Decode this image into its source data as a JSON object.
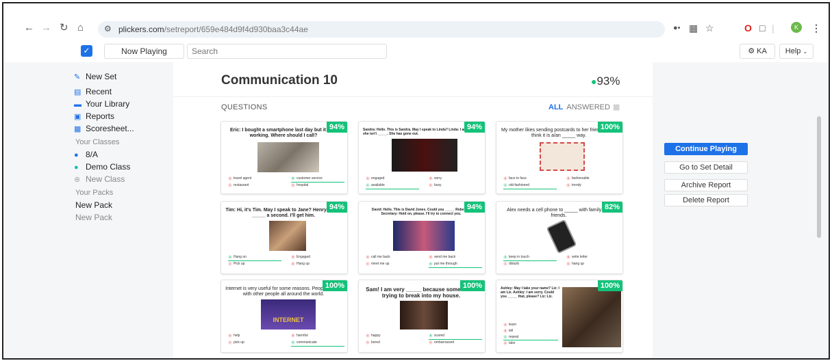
{
  "browser": {
    "url_host": "plickers.com",
    "url_path": "/setreport/659e484d9f4d930baa3c44ae",
    "profile_initial": "K"
  },
  "header": {
    "now_playing": "Now Playing",
    "search_placeholder": "Search",
    "account": "KA",
    "help": "Help"
  },
  "sidebar": {
    "new_set": "New Set",
    "recent": "Recent",
    "library": "Your Library",
    "reports": "Reports",
    "scoresheet": "Scoresheet...",
    "classes_head": "Your Classes",
    "class1": "8/A",
    "class2": "Demo Class",
    "new_class": "New Class",
    "packs_head": "Your Packs",
    "pack1": "New Pack",
    "pack2": "New Pack"
  },
  "main": {
    "title": "Communication 10",
    "score": "93%",
    "questions_label": "QUESTIONS",
    "filter_all": "ALL",
    "filter_answered": "ANSWERED"
  },
  "cards": [
    {
      "pct": "94%",
      "q": "Eric: I bought a smartphone last day but it isn't working. Where should I call?",
      "a": "travel agent",
      "b": "customer service",
      "c": "restaurant",
      "d": "hospital"
    },
    {
      "pct": "94%",
      "q": "Sandra: Hello. This is Sandra. May I speak to Linda? Linda: I am afraid she isn't _____. She has gone out.",
      "a": "engaged",
      "b": "sorry",
      "c": "available",
      "d": "busy"
    },
    {
      "pct": "100%",
      "q": "My mother likes sending postcards to her friends, but I think it is a/an _____ way.",
      "a": "face to face",
      "b": "fashionable",
      "c": "old-fashioned",
      "d": "trendy"
    },
    {
      "pct": "94%",
      "q": "Tim: Hi, it's Tim. May I speak to Jane? Henry: Sure, _____ a second. I'll get him.",
      "a": "Hang on",
      "b": "Engaged",
      "c": "Pick up",
      "d": "Hang up"
    },
    {
      "pct": "94%",
      "q": "David: Hello. This is David Jones. Could you _____ Roberts? Secretary: Hold on, please. I'll try to connect you.",
      "a": "call me back",
      "b": "send me back",
      "c": "meet me up",
      "d": "put me through"
    },
    {
      "pct": "82%",
      "q": "Alex needs a cell phone to _____ with family and friends.",
      "a": "keep in touch",
      "b": "write letter",
      "c": "disturb",
      "d": "hang up"
    },
    {
      "pct": "100%",
      "q": "Internet is very useful for some reasons. People _____ with other people all around the world.",
      "a": "help",
      "b": "harmful",
      "c": "pick up",
      "d": "communicate",
      "img_text": "INTERNET"
    },
    {
      "pct": "100%",
      "q": "Sam! I am very _____ because someone is trying to break into my house.",
      "a": "happy",
      "b": "scared",
      "c": "bored",
      "d": "embarrassed"
    },
    {
      "pct": "100%",
      "q": "Ashley: May I take your name? Liz: I am Liz. Ashley: I am sorry. Could you _____ that, please? Liz: Liz.",
      "a": "learn",
      "b": "tell",
      "c": "repeat",
      "d": "take"
    }
  ],
  "right_panel": {
    "continue": "Continue Playing",
    "detail": "Go to Set Detail",
    "archive": "Archive Report",
    "delete": "Delete Report"
  },
  "colors": {
    "accent": "#1e72e8",
    "success": "#14c27a"
  }
}
